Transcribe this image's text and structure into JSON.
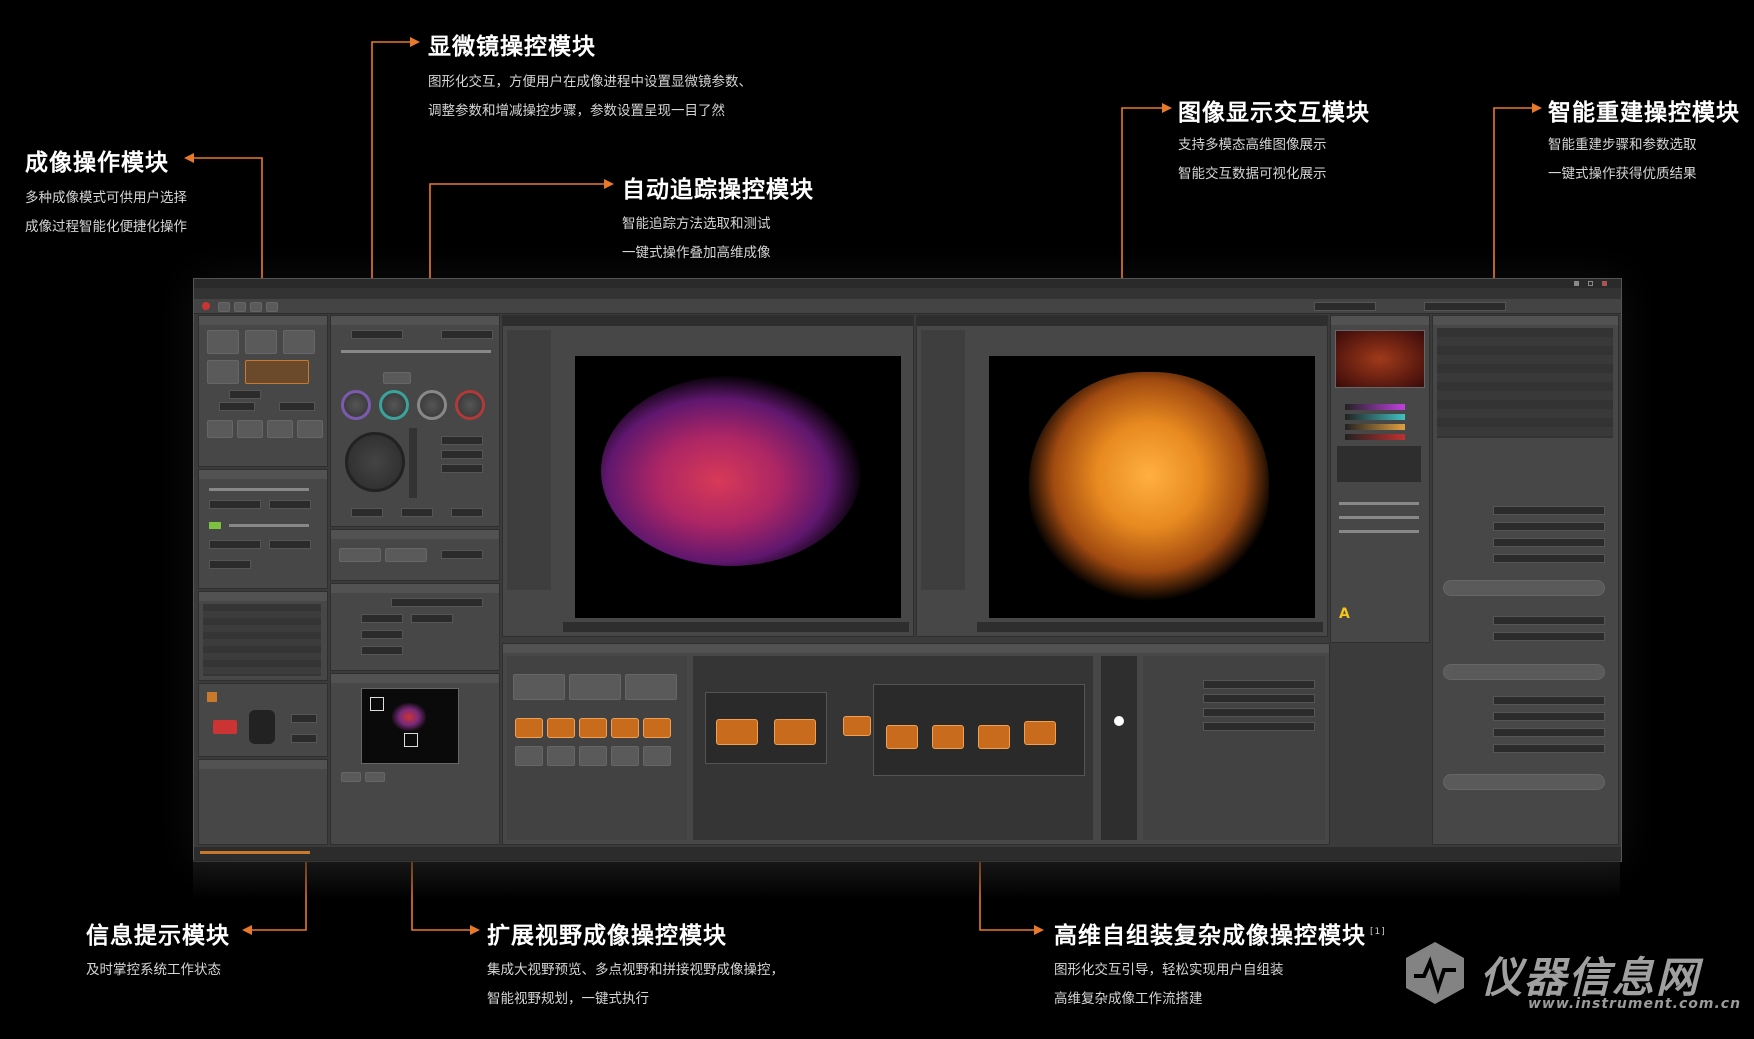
{
  "callouts": {
    "imaging": {
      "title": "成像操作模块",
      "lines": [
        "多种成像模式可供用户选择",
        "成像过程智能化便捷化操作"
      ]
    },
    "microscope": {
      "title": "显微镜操控模块",
      "lines": [
        "图形化交互，方便用户在成像进程中设置显微镜参数、",
        "调整参数和增减操控步骤，参数设置呈现一目了然"
      ]
    },
    "tracking": {
      "title": "自动追踪操控模块",
      "lines": [
        "智能追踪方法选取和测试",
        "一键式操作叠加高维成像"
      ]
    },
    "display": {
      "title": "图像显示交互模块",
      "lines": [
        "支持多模态高维图像展示",
        "智能交互数据可视化展示"
      ]
    },
    "reconstruction": {
      "title": "智能重建操控模块",
      "lines": [
        "智能重建步骤和参数选取",
        "一键式操作获得优质结果"
      ]
    },
    "info": {
      "title": "信息提示模块",
      "lines": [
        "及时掌控系统工作状态"
      ]
    },
    "fov": {
      "title": "扩展视野成像操控模块",
      "lines": [
        "集成大视野预览、多点视野和拼接视野成像操控，",
        "智能视野规划，一键式执行"
      ]
    },
    "workflow": {
      "title": "高维自组装复杂成像操控模块",
      "sup": "[1]",
      "lines": [
        "图形化交互引导，轻松实现用户自组装",
        "高维复杂成像工作流搭建"
      ]
    }
  },
  "watermark": {
    "text": "仪器信息网",
    "url": "www.instrument.com.cn"
  },
  "colors": {
    "accent": "#e8792a",
    "background": "#000000",
    "window": "#3b3b3b"
  }
}
